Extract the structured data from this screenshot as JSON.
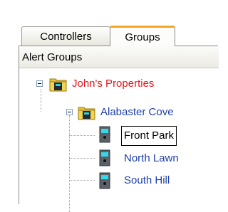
{
  "tabs": [
    {
      "label": "Controllers"
    },
    {
      "label": "Groups"
    }
  ],
  "panel": {
    "title": "Alert Groups"
  },
  "tree": {
    "root": {
      "label": "John's Properties",
      "icon": "folder-icon",
      "color": "#e8141a"
    },
    "child": {
      "label": "Alabaster Cove",
      "icon": "folder-icon",
      "color": "#1e3fa8"
    },
    "leaves": [
      {
        "label": "Front Park",
        "icon": "controller-icon",
        "selected": true
      },
      {
        "label": "North Lawn",
        "icon": "controller-icon"
      },
      {
        "label": "South Hill",
        "icon": "controller-icon"
      }
    ]
  },
  "colors": {
    "active_tab_accent": "#f5a623",
    "leaf_text": "#1e3fa8"
  }
}
